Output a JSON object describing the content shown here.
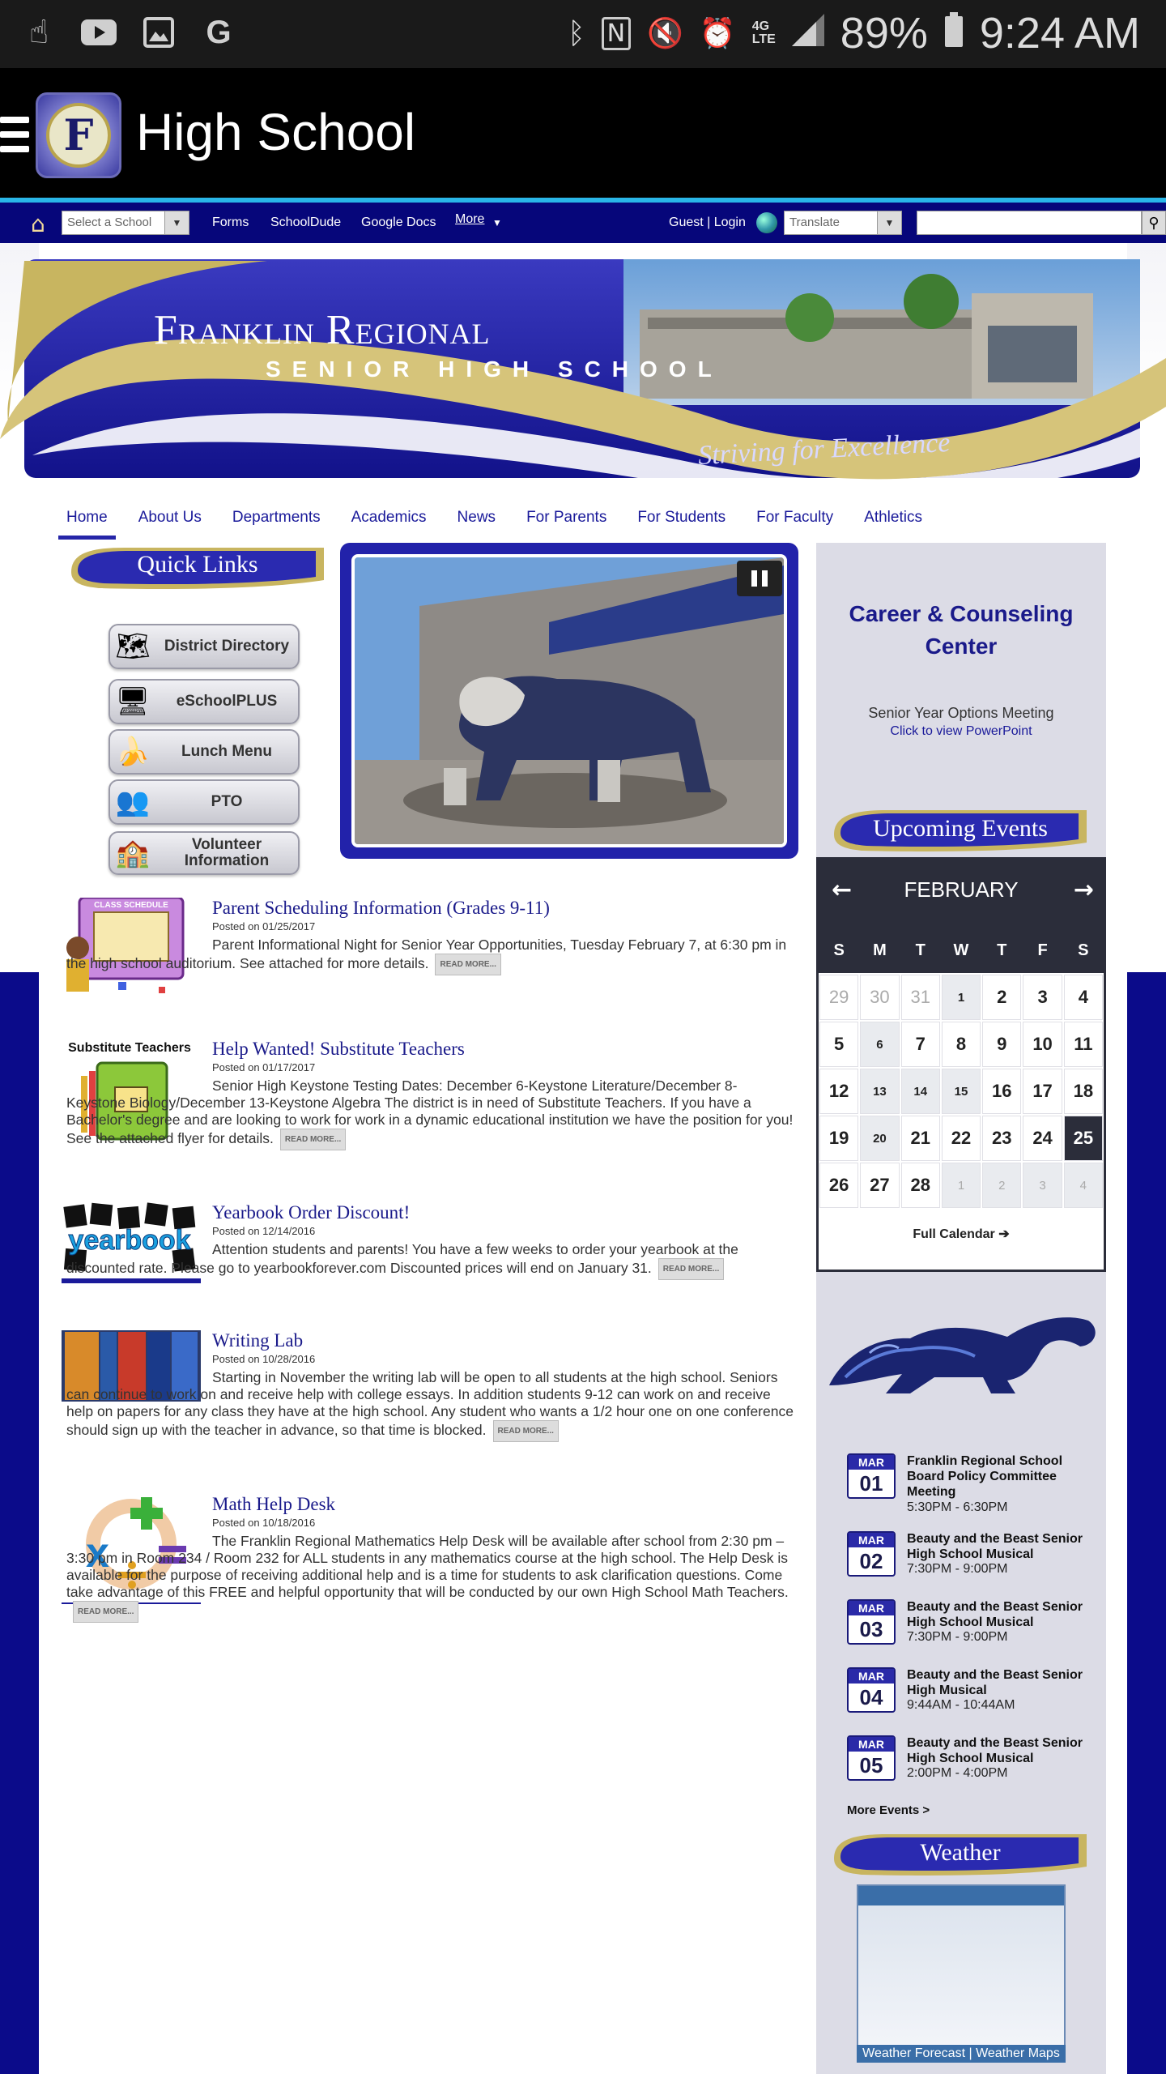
{
  "status_bar": {
    "left_icons": [
      "touch-icon",
      "youtube-icon",
      "gallery-icon",
      "google-icon"
    ],
    "right_icons": [
      "bluetooth-icon",
      "nfc-icon",
      "mute-icon",
      "alarm-icon",
      "lte-icon",
      "signal-icon"
    ],
    "battery": "89%",
    "time": "9:24 AM"
  },
  "app_bar": {
    "title": "High School"
  },
  "util_nav": {
    "school_select": "Select a School",
    "links": [
      "Forms",
      "SchoolDude",
      "Google Docs"
    ],
    "more": "More",
    "login": "Guest | Login",
    "translate": "Translate"
  },
  "banner": {
    "title": "Franklin Regional",
    "subtitle": "SENIOR HIGH SCHOOL",
    "tagline": "Striving for Excellence"
  },
  "main_nav": [
    "Home",
    "About Us",
    "Departments",
    "Academics",
    "News",
    "For Parents",
    "For Students",
    "For Faculty",
    "Athletics"
  ],
  "quick_links": {
    "title": "Quick Links",
    "items": [
      {
        "label": "District Directory",
        "icon": "map-icon"
      },
      {
        "label": "eSchoolPLUS",
        "icon": "computer-icon"
      },
      {
        "label": "Lunch Menu",
        "icon": "banana-icon"
      },
      {
        "label": "PTO",
        "icon": "people-icon"
      },
      {
        "label": "Volunteer Information",
        "icon": "building-icon"
      }
    ]
  },
  "counseling": {
    "title": "Career & Counseling Center",
    "subtitle": "Senior Year Options Meeting",
    "link": "Click to view PowerPoint"
  },
  "upcoming_events": {
    "title": "Upcoming Events",
    "calendar": {
      "month": "FEBRUARY",
      "days_of_week": [
        "S",
        "M",
        "T",
        "W",
        "T",
        "F",
        "S"
      ],
      "full_calendar": "Full Calendar ➔",
      "cells": [
        {
          "d": "29",
          "t": "other"
        },
        {
          "d": "30",
          "t": "other"
        },
        {
          "d": "31",
          "t": "other"
        },
        {
          "d": "1",
          "t": "small"
        },
        {
          "d": "2",
          "t": ""
        },
        {
          "d": "3",
          "t": ""
        },
        {
          "d": "4",
          "t": ""
        },
        {
          "d": "5",
          "t": ""
        },
        {
          "d": "6",
          "t": "small"
        },
        {
          "d": "7",
          "t": ""
        },
        {
          "d": "8",
          "t": ""
        },
        {
          "d": "9",
          "t": ""
        },
        {
          "d": "10",
          "t": ""
        },
        {
          "d": "11",
          "t": ""
        },
        {
          "d": "12",
          "t": ""
        },
        {
          "d": "13",
          "t": "small"
        },
        {
          "d": "14",
          "t": "small"
        },
        {
          "d": "15",
          "t": "small"
        },
        {
          "d": "16",
          "t": ""
        },
        {
          "d": "17",
          "t": ""
        },
        {
          "d": "18",
          "t": ""
        },
        {
          "d": "19",
          "t": ""
        },
        {
          "d": "20",
          "t": "small"
        },
        {
          "d": "21",
          "t": ""
        },
        {
          "d": "22",
          "t": ""
        },
        {
          "d": "23",
          "t": ""
        },
        {
          "d": "24",
          "t": ""
        },
        {
          "d": "25",
          "t": "today"
        },
        {
          "d": "26",
          "t": ""
        },
        {
          "d": "27",
          "t": ""
        },
        {
          "d": "28",
          "t": ""
        },
        {
          "d": "1",
          "t": "other small"
        },
        {
          "d": "2",
          "t": "other small"
        },
        {
          "d": "3",
          "t": "other small"
        },
        {
          "d": "4",
          "t": "other small"
        }
      ]
    },
    "events": [
      {
        "month": "MAR",
        "day": "01",
        "title": "Franklin Regional School Board Policy Committee Meeting",
        "time": "5:30PM - 6:30PM"
      },
      {
        "month": "MAR",
        "day": "02",
        "title": "Beauty and the Beast Senior High School Musical",
        "time": "7:30PM - 9:00PM"
      },
      {
        "month": "MAR",
        "day": "03",
        "title": "Beauty and the Beast Senior High School Musical",
        "time": "7:30PM - 9:00PM"
      },
      {
        "month": "MAR",
        "day": "04",
        "title": "Beauty and the Beast Senior High Musical",
        "time": "9:44AM - 10:44AM"
      },
      {
        "month": "MAR",
        "day": "05",
        "title": "Beauty and the Beast Senior High School Musical",
        "time": "2:00PM - 4:00PM"
      }
    ],
    "more_events": "More Events >"
  },
  "weather": {
    "title": "Weather",
    "links": "Weather Forecast | Weather Maps"
  },
  "news": [
    {
      "title": "Parent Scheduling Information (Grades 9-11)",
      "date": "Posted on 01/25/2017",
      "body": "Parent Informational Night for Senior Year Opportunities, Tuesday February 7, at 6:30 pm in the high school auditorium. See attached for more details.",
      "thumb_label": "CLASS SCHEDULE",
      "read_more": "READ MORE..."
    },
    {
      "title": "Help Wanted! Substitute Teachers",
      "date": "Posted on 01/17/2017",
      "body": "Senior High Keystone Testing Dates: December 6-Keystone Literature/December 8-Keystone Biology/December 13-Keystone Algebra The district is in need of Substitute Teachers. If you have a Bachelor's degree and are looking to work for work in a dynamic educational institution we have the position for you! See the attached flyer for details.",
      "thumb_label": "Substitute Teachers",
      "read_more": "READ MORE..."
    },
    {
      "title": "Yearbook Order Discount!",
      "date": "Posted on 12/14/2016",
      "body": "Attention students and parents! You have a few weeks to order your yearbook at the discounted rate. Please go to yearbookforever.com Discounted prices will end on January 31.",
      "thumb_label": "yearbook",
      "read_more": "READ MORE..."
    },
    {
      "title": "Writing Lab",
      "date": "Posted on 10/28/2016",
      "body": "Starting in November the writing lab will be open to all students at the high school. Seniors can continue to work on and receive help with college essays. In addition students 9-12 can work on and receive help on papers for any class they have at the high school. Any student who wants a 1/2 hour one on one conference should sign up with the teacher in advance, so that time is blocked.",
      "read_more": "READ MORE..."
    },
    {
      "title": "Math Help Desk",
      "date": "Posted on 10/18/2016",
      "body": "The Franklin Regional Mathematics Help Desk will be available after school from 2:30 pm – 3:30 pm in Room 234 / Room 232 for ALL students in any mathematics course at the high school. The Help Desk is available for the purpose of receiving additional help and is a time for students to ask clarification questions. Come take advantage of this FREE and helpful opportunity that will be conducted by our own High School Math Teachers.",
      "read_more": "READ MORE..."
    }
  ],
  "colors": {
    "navy": "#0b0b8a",
    "royal": "#2525a8",
    "gold": "#c8b560",
    "calendar_dark": "#2b2d3a",
    "sidebar": "#dcdce6"
  }
}
